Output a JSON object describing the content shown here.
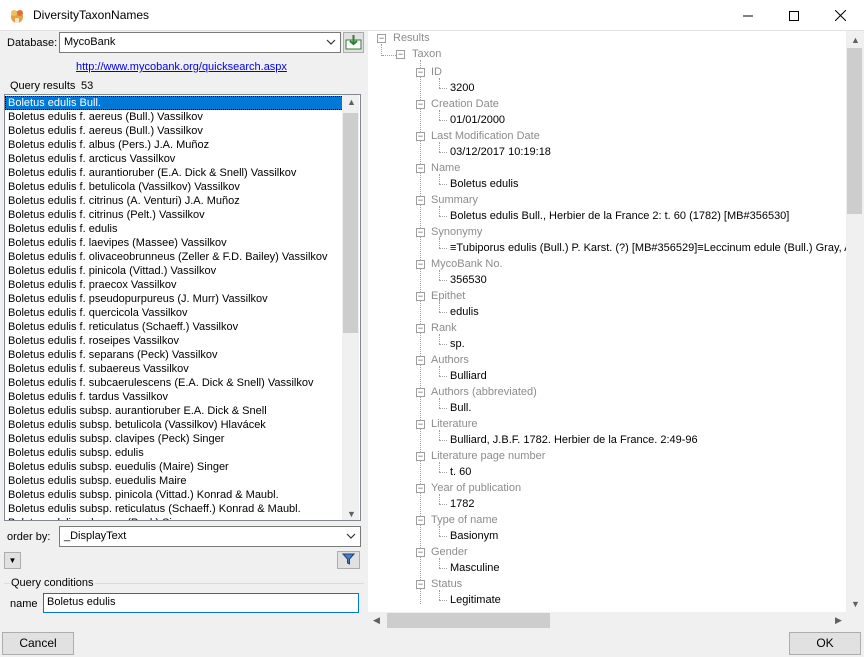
{
  "window": {
    "title": "DiversityTaxonNames",
    "icon": "app-icon"
  },
  "database": {
    "label": "Database:",
    "selected": "MycoBank",
    "link": "http://www.mycobank.org/quicksearch.aspx"
  },
  "query_results": {
    "label": "Query results",
    "count": "53",
    "items": [
      "Boletus edulis Bull.",
      "Boletus edulis f. aereus (Bull.) Vassilkov",
      "Boletus edulis f. aereus (Bull.) Vassilkov",
      "Boletus edulis f. albus (Pers.) J.A. Muñoz",
      "Boletus edulis f. arcticus Vassilkov",
      "Boletus edulis f. aurantioruber (E.A. Dick & Snell) Vassilkov",
      "Boletus edulis f. betulicola (Vassilkov) Vassilkov",
      "Boletus edulis f. citrinus (A. Venturi) J.A. Muñoz",
      "Boletus edulis f. citrinus (Pelt.) Vassilkov",
      "Boletus edulis f. edulis",
      "Boletus edulis f. laevipes (Massee) Vassilkov",
      "Boletus edulis f. olivaceobrunneus (Zeller & F.D. Bailey) Vassilkov",
      "Boletus edulis f. pinicola (Vittad.) Vassilkov",
      "Boletus edulis f. praecox Vassilkov",
      "Boletus edulis f. pseudopurpureus (J. Murr) Vassilkov",
      "Boletus edulis f. quercicola Vassilkov",
      "Boletus edulis f. reticulatus (Schaeff.) Vassilkov",
      "Boletus edulis f. roseipes Vassilkov",
      "Boletus edulis f. separans (Peck) Vassilkov",
      "Boletus edulis f. subaereus Vassilkov",
      "Boletus edulis f. subcaerulescens (E.A. Dick & Snell) Vassilkov",
      "Boletus edulis f. tardus Vassilkov",
      "Boletus edulis subsp. aurantioruber E.A. Dick & Snell",
      "Boletus edulis subsp. betulicola (Vassilkov) Hlavácek",
      "Boletus edulis subsp. clavipes (Peck) Singer",
      "Boletus edulis subsp. edulis",
      "Boletus edulis subsp. euedulis (Maire) Singer",
      "Boletus edulis subsp. euedulis Maire",
      "Boletus edulis subsp. pinicola (Vittad.) Konrad & Maubl.",
      "Boletus edulis subsp. reticulatus (Schaeff.) Konrad & Maubl.",
      "Boletus edulis subsp. ... (Peck) Singer"
    ]
  },
  "order_by": {
    "label": "order by:",
    "selected": "_DisplayText"
  },
  "query_conditions": {
    "label": "Query conditions",
    "name_label": "name",
    "name_value": "Boletus edulis"
  },
  "tree": {
    "root": "Results",
    "taxon": "Taxon",
    "fields": [
      {
        "label": "ID",
        "value": "3200"
      },
      {
        "label": "Creation Date",
        "value": "01/01/2000"
      },
      {
        "label": "Last Modification Date",
        "value": "03/12/2017 10:19:18"
      },
      {
        "label": "Name",
        "value": "Boletus edulis"
      },
      {
        "label": "Summary",
        "value": "Boletus edulis Bull., Herbier de la France 2: t. 60 (1782) [MB#356530]"
      },
      {
        "label": "Synonymy",
        "value": "≡Tubiporus edulis (Bull.) P. Karst. (?) [MB#356529]≡Leccinum edule (Bull.) Gray, A na"
      },
      {
        "label": "MycoBank No.",
        "value": "356530"
      },
      {
        "label": "Epithet",
        "value": "edulis"
      },
      {
        "label": "Rank",
        "value": "sp."
      },
      {
        "label": "Authors",
        "value": "Bulliard"
      },
      {
        "label": "Authors (abbreviated)",
        "value": "Bull."
      },
      {
        "label": "Literature",
        "value": "Bulliard, J.B.F. 1782. Herbier de la France. 2:49-96"
      },
      {
        "label": "Literature page number",
        "value": "t. 60"
      },
      {
        "label": "Year of publication",
        "value": "1782"
      },
      {
        "label": "Type of name",
        "value": "Basionym"
      },
      {
        "label": "Gender",
        "value": "Masculine"
      },
      {
        "label": "Status",
        "value": "Legitimate"
      }
    ]
  },
  "buttons": {
    "cancel": "Cancel",
    "ok": "OK"
  }
}
